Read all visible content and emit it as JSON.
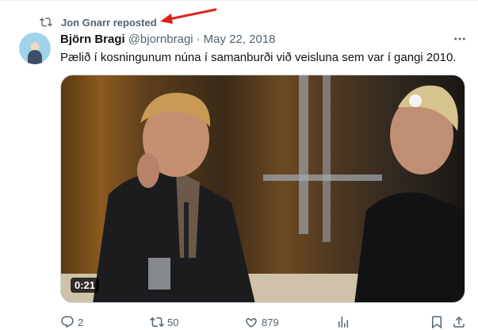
{
  "repost": {
    "text": "Jon Gnarr reposted",
    "icon": "repost-icon"
  },
  "tweet": {
    "author_name": "Björn Bragi",
    "handle": "@bjornbragi",
    "separator": "·",
    "date": "May 22, 2018",
    "text": "Pælið í kosningunum núna í samanburði við veisluna sem var í gangi 2010.",
    "media": {
      "duration": "0:21"
    }
  },
  "actions": {
    "replies": "2",
    "reposts": "50",
    "likes": "879"
  },
  "colors": {
    "annotation_arrow": "#e0201b",
    "muted": "#536471",
    "text": "#0f1419"
  }
}
